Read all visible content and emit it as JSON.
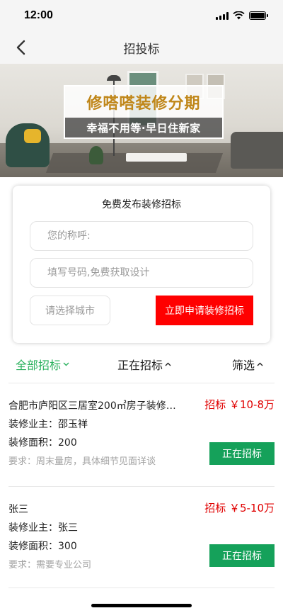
{
  "status_bar": {
    "time": "12:00"
  },
  "nav": {
    "title": "招投标"
  },
  "banner": {
    "headline": "修嗒嗒装修分期",
    "subline": "幸福不用等·早日住新家"
  },
  "form": {
    "title": "免费发布装修招标",
    "name_placeholder": "您的称呼:",
    "phone_placeholder": "填写号码,免费获取设计",
    "city_label": "请选择城市",
    "submit_label": "立即申请装修招标"
  },
  "filters": {
    "all": "全部招标",
    "bidding": "正在招标",
    "screen": "筛选"
  },
  "listings": [
    {
      "title": "合肥市庐阳区三居室200㎡房子装修…",
      "price": "招标 ￥10-8万",
      "owner": "装修业主：邵玉祥",
      "area": "装修面积：200",
      "note": "要求：周末量房，具体细节见面详谈",
      "status": "正在招标"
    },
    {
      "title": "张三",
      "price": "招标 ￥5-10万",
      "owner": "装修业主：张三",
      "area": "装修面积：300",
      "note": "要求：需要专业公司",
      "status": "正在招标"
    }
  ],
  "colors": {
    "accent_green": "#2bb15e",
    "button_green": "#15a15a",
    "price_red": "#e00000",
    "apply_red": "#ff0000"
  }
}
